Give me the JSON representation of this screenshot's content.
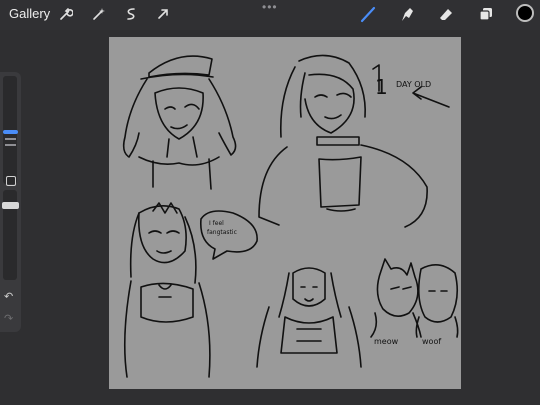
{
  "topbar": {
    "gallery_label": "Gallery",
    "icons": [
      "wrench-icon",
      "magic-wand-icon",
      "selection-icon",
      "transform-arrow-icon"
    ],
    "right_icons": [
      "brush-icon",
      "smudge-icon",
      "eraser-icon",
      "layers-icon"
    ],
    "more_label": "•••",
    "current_color": "#000000",
    "accent": "#4a8df8"
  },
  "sidebar": {
    "undo_label": "↶",
    "redo_label": "↷"
  },
  "canvas": {
    "annotation_number": "1",
    "annotation_text": "DAY OLD",
    "speech_line1": "I feel",
    "speech_line2": "fangtastic",
    "label_meow": "meow",
    "label_woof": "woof"
  }
}
